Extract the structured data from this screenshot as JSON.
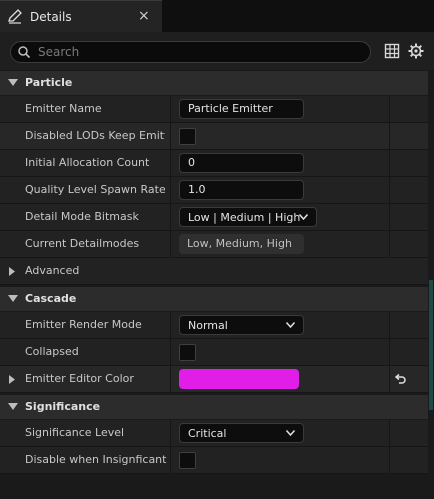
{
  "tab": {
    "title": "Details",
    "close": "×"
  },
  "search": {
    "placeholder": "Search",
    "value": ""
  },
  "sections": {
    "particle": "Particle",
    "cascade": "Cascade",
    "significance": "Significance"
  },
  "rows": {
    "emitter_name": {
      "label": "Emitter Name",
      "value": "Particle Emitter"
    },
    "disabled_lods": {
      "label": "Disabled LODs Keep Emitt...",
      "checked": false
    },
    "initial_allocation": {
      "label": "Initial Allocation Count",
      "value": "0"
    },
    "quality_level": {
      "label": "Quality Level Spawn Rate...",
      "value": "1.0"
    },
    "detail_mode": {
      "label": "Detail Mode Bitmask",
      "value": "Low | Medium | High"
    },
    "current_detailmodes": {
      "label": "Current Detailmodes",
      "value": "Low, Medium, High"
    },
    "advanced": {
      "label": "Advanced"
    },
    "emitter_render_mode": {
      "label": "Emitter Render Mode",
      "value": "Normal"
    },
    "collapsed": {
      "label": "Collapsed",
      "checked": false
    },
    "emitter_editor_color": {
      "label": "Emitter Editor Color",
      "color": "#e01ee8"
    },
    "significance_level": {
      "label": "Significance Level",
      "value": "Critical"
    },
    "disable_insignificant": {
      "label": "Disable when Insignficant",
      "checked": false
    }
  },
  "colors": {
    "accent": "#e01ee8",
    "background": "#1a1a1a",
    "section": "#2c2c2c"
  },
  "icons": [
    "details-pencil-icon",
    "close-icon",
    "search-icon",
    "grid-icon",
    "gear-icon",
    "chevron-down-icon",
    "chevron-right-icon",
    "reset-arrow-icon"
  ]
}
